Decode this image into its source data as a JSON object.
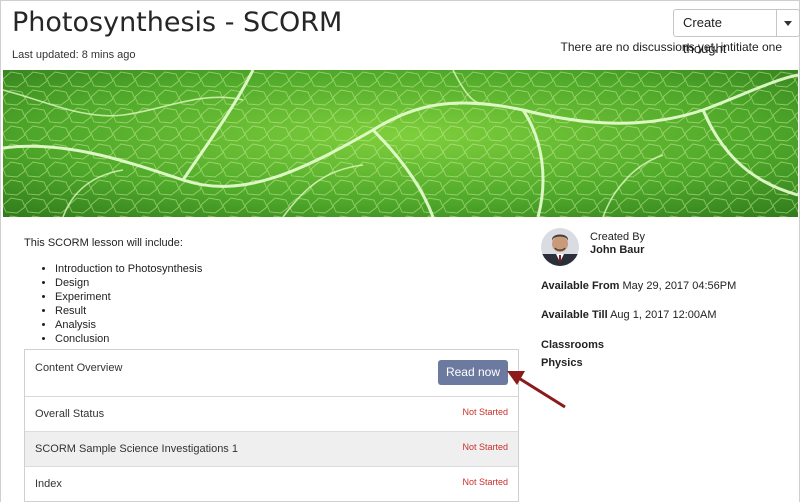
{
  "header": {
    "title": "Photosynthesis - SCORM",
    "last_updated": "Last updated: 8 mins ago",
    "create_button": "Create thought",
    "discussion_note": "There are no discussions yet, intitiate one"
  },
  "lesson": {
    "intro": "This SCORM lesson will include:",
    "topics": [
      "Introduction to Photosynthesis",
      "Design",
      "Experiment",
      "Result",
      "Analysis",
      "Conclusion"
    ]
  },
  "overview": {
    "title": "Content Overview",
    "read_button": "Read now",
    "rows": [
      {
        "label": "Overall Status",
        "status": "Not Started"
      },
      {
        "label": "SCORM Sample Science Investigations 1",
        "status": "Not Started"
      },
      {
        "label": "Index",
        "status": "Not Started"
      }
    ]
  },
  "sidebar": {
    "created_by_label": "Created By",
    "creator": "John Baur",
    "available_from_label": "Available From",
    "available_from": "May 29, 2017 04:56PM",
    "available_till_label": "Available Till",
    "available_till": "Aug 1, 2017 12:00AM",
    "classrooms_label": "Classrooms",
    "classroom": "Physics"
  },
  "colors": {
    "read_button": "#6d7aa0",
    "status_not_started": "#c9302c",
    "annotation_arrow": "#8b1a1a"
  }
}
